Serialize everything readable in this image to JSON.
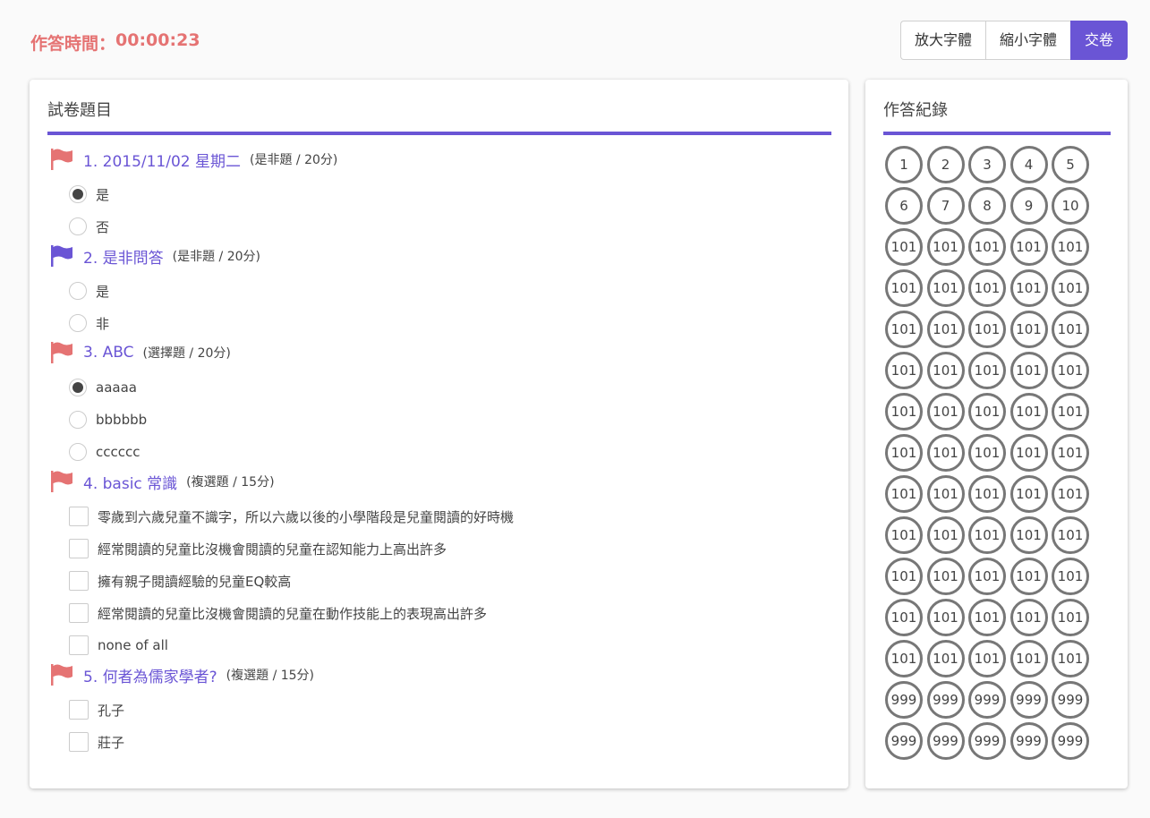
{
  "header": {
    "timer_label": "作答時間：",
    "timer_value": "00:00:23",
    "btn_zoom_in": "放大字體",
    "btn_zoom_out": "縮小字體",
    "btn_submit": "交卷"
  },
  "colors": {
    "accent": "#6a55d5",
    "flag_red": "#e57373",
    "flag_blue": "#6a55d5"
  },
  "main": {
    "title": "試卷題目"
  },
  "questions": [
    {
      "title": "1. 2015/11/02 星期二",
      "type": "(是非題 / 20分)",
      "flag": "red",
      "input": "radio",
      "options": [
        {
          "label": "是",
          "checked": true
        },
        {
          "label": "否",
          "checked": false
        }
      ]
    },
    {
      "title": "2. 是非問答",
      "type": "(是非題 / 20分)",
      "flag": "blue",
      "input": "radio",
      "options": [
        {
          "label": "是",
          "checked": false
        },
        {
          "label": "非",
          "checked": false
        }
      ]
    },
    {
      "title": "3. ABC",
      "type": "(選擇題 / 20分)",
      "flag": "red",
      "input": "radio",
      "options": [
        {
          "label": "aaaaa",
          "checked": true
        },
        {
          "label": "bbbbbb",
          "checked": false
        },
        {
          "label": "cccccc",
          "checked": false
        }
      ]
    },
    {
      "title": "4. basic 常識",
      "type": "(複選題 / 15分)",
      "flag": "red",
      "input": "checkbox",
      "options": [
        {
          "label": "零歲到六歲兒童不識字，所以六歲以後的小學階段是兒童閱讀的好時機",
          "checked": false
        },
        {
          "label": "經常閱讀的兒童比沒機會閱讀的兒童在認知能力上高出許多",
          "checked": false
        },
        {
          "label": "擁有親子閱讀經驗的兒童EQ較高",
          "checked": false
        },
        {
          "label": "經常閱讀的兒童比沒機會閱讀的兒童在動作技能上的表現高出許多",
          "checked": false
        },
        {
          "label": "none of all",
          "checked": false
        }
      ]
    },
    {
      "title": "5. 何者為儒家學者?",
      "type": "(複選題 / 15分)",
      "flag": "red",
      "input": "checkbox",
      "options": [
        {
          "label": "孔子",
          "checked": false
        },
        {
          "label": "莊子",
          "checked": false
        }
      ]
    }
  ],
  "side": {
    "title": "作答紀錄",
    "items": [
      "1",
      "2",
      "3",
      "4",
      "5",
      "6",
      "7",
      "8",
      "9",
      "10",
      "101",
      "101",
      "101",
      "101",
      "101",
      "101",
      "101",
      "101",
      "101",
      "101",
      "101",
      "101",
      "101",
      "101",
      "101",
      "101",
      "101",
      "101",
      "101",
      "101",
      "101",
      "101",
      "101",
      "101",
      "101",
      "101",
      "101",
      "101",
      "101",
      "101",
      "101",
      "101",
      "101",
      "101",
      "101",
      "101",
      "101",
      "101",
      "101",
      "101",
      "101",
      "101",
      "101",
      "101",
      "101",
      "101",
      "101",
      "101",
      "101",
      "101",
      "101",
      "101",
      "101",
      "101",
      "101",
      "999",
      "999",
      "999",
      "999",
      "999",
      "999",
      "999",
      "999",
      "999",
      "999"
    ]
  }
}
